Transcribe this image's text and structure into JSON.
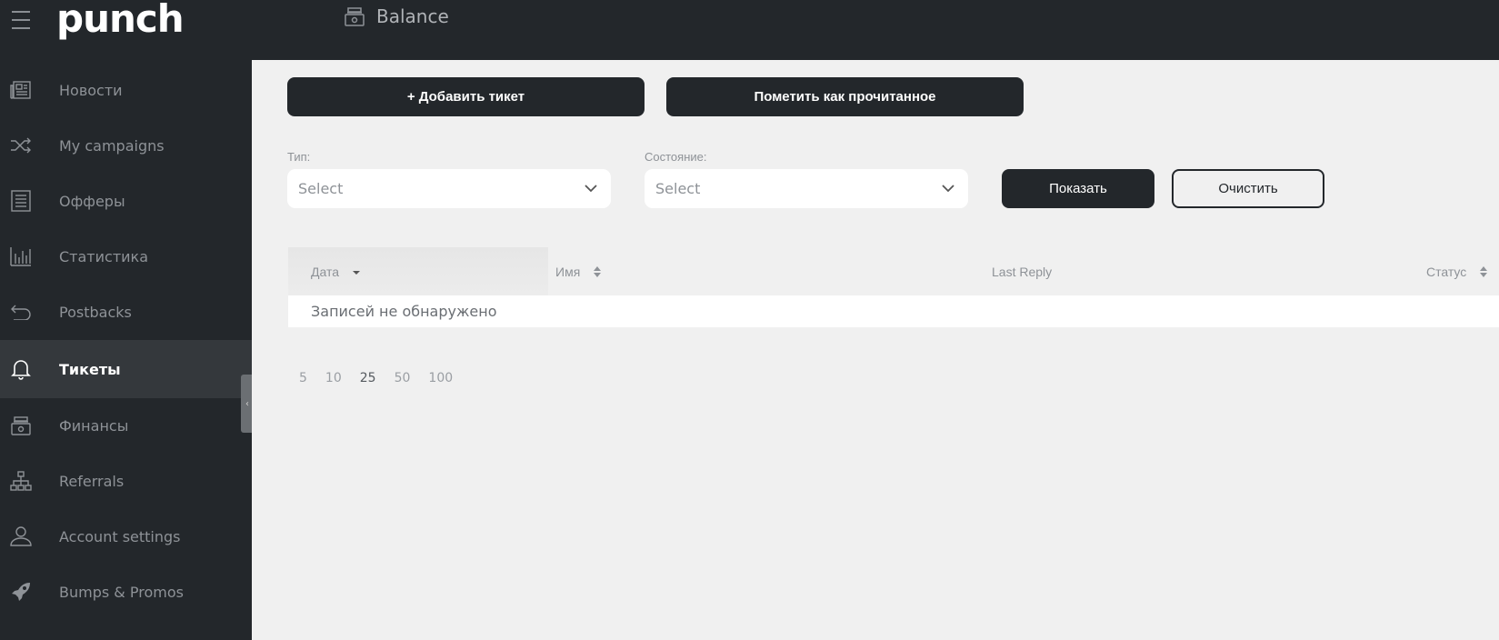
{
  "header": {
    "logo_text": "punch",
    "balance_label": "Balance"
  },
  "sidebar": {
    "items": [
      {
        "label": "Новости",
        "icon": "newspaper-icon"
      },
      {
        "label": "My campaigns",
        "icon": "shuffle-icon"
      },
      {
        "label": "Офферы",
        "icon": "list-icon"
      },
      {
        "label": "Статистика",
        "icon": "bar-chart-icon"
      },
      {
        "label": "Postbacks",
        "icon": "return-arrow-icon"
      },
      {
        "label": "Тикеты",
        "icon": "bell-icon",
        "active": true
      },
      {
        "label": "Финансы",
        "icon": "cash-register-icon"
      },
      {
        "label": "Referrals",
        "icon": "org-chart-icon"
      },
      {
        "label": "Account settings",
        "icon": "user-icon"
      },
      {
        "label": "Bumps & Promos",
        "icon": "rocket-icon"
      }
    ]
  },
  "toolbar": {
    "add_ticket": "+ Добавить тикет",
    "mark_read": "Пометить как прочитанное"
  },
  "filters": {
    "type_label": "Тип:",
    "type_value": "Select",
    "state_label": "Состояние:",
    "state_value": "Select",
    "show": "Показать",
    "clear": "Очистить"
  },
  "table": {
    "columns": [
      "Дата",
      "Имя",
      "Last Reply",
      "Статус"
    ],
    "empty_text": "Записей не обнаружено"
  },
  "pagination": {
    "sizes": [
      "5",
      "10",
      "25",
      "50",
      "100"
    ],
    "current": "25"
  },
  "colors": {
    "dark": "#23272b",
    "sidebar_active": "#34383c",
    "background": "#f0f0f0"
  }
}
